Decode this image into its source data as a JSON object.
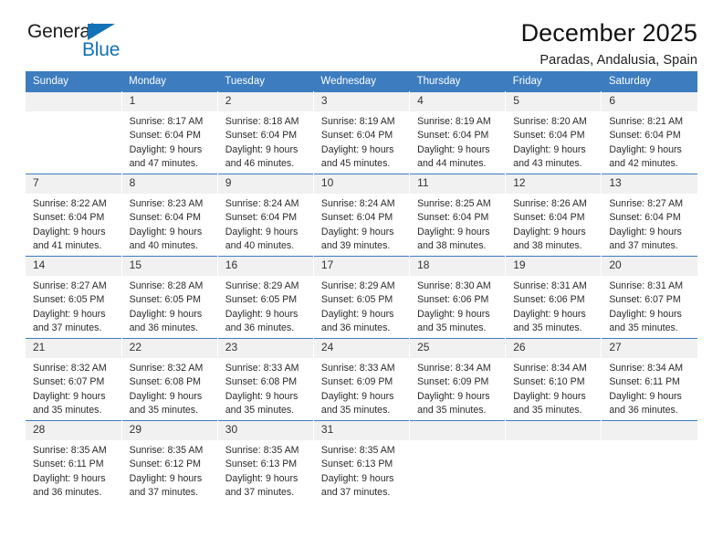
{
  "logo": {
    "general": "General",
    "blue": "Blue",
    "triangle_color": "#1272b6"
  },
  "header": {
    "title": "December 2025",
    "subtitle": "Paradas, Andalusia, Spain",
    "accent_color": "#3c7cbf"
  },
  "weekday_headers": [
    "Sunday",
    "Monday",
    "Tuesday",
    "Wednesday",
    "Thursday",
    "Friday",
    "Saturday"
  ],
  "weeks": [
    [
      {
        "day": "",
        "lines": []
      },
      {
        "day": "1",
        "lines": [
          "Sunrise: 8:17 AM",
          "Sunset: 6:04 PM",
          "Daylight: 9 hours",
          "and 47 minutes."
        ]
      },
      {
        "day": "2",
        "lines": [
          "Sunrise: 8:18 AM",
          "Sunset: 6:04 PM",
          "Daylight: 9 hours",
          "and 46 minutes."
        ]
      },
      {
        "day": "3",
        "lines": [
          "Sunrise: 8:19 AM",
          "Sunset: 6:04 PM",
          "Daylight: 9 hours",
          "and 45 minutes."
        ]
      },
      {
        "day": "4",
        "lines": [
          "Sunrise: 8:19 AM",
          "Sunset: 6:04 PM",
          "Daylight: 9 hours",
          "and 44 minutes."
        ]
      },
      {
        "day": "5",
        "lines": [
          "Sunrise: 8:20 AM",
          "Sunset: 6:04 PM",
          "Daylight: 9 hours",
          "and 43 minutes."
        ]
      },
      {
        "day": "6",
        "lines": [
          "Sunrise: 8:21 AM",
          "Sunset: 6:04 PM",
          "Daylight: 9 hours",
          "and 42 minutes."
        ]
      }
    ],
    [
      {
        "day": "7",
        "lines": [
          "Sunrise: 8:22 AM",
          "Sunset: 6:04 PM",
          "Daylight: 9 hours",
          "and 41 minutes."
        ]
      },
      {
        "day": "8",
        "lines": [
          "Sunrise: 8:23 AM",
          "Sunset: 6:04 PM",
          "Daylight: 9 hours",
          "and 40 minutes."
        ]
      },
      {
        "day": "9",
        "lines": [
          "Sunrise: 8:24 AM",
          "Sunset: 6:04 PM",
          "Daylight: 9 hours",
          "and 40 minutes."
        ]
      },
      {
        "day": "10",
        "lines": [
          "Sunrise: 8:24 AM",
          "Sunset: 6:04 PM",
          "Daylight: 9 hours",
          "and 39 minutes."
        ]
      },
      {
        "day": "11",
        "lines": [
          "Sunrise: 8:25 AM",
          "Sunset: 6:04 PM",
          "Daylight: 9 hours",
          "and 38 minutes."
        ]
      },
      {
        "day": "12",
        "lines": [
          "Sunrise: 8:26 AM",
          "Sunset: 6:04 PM",
          "Daylight: 9 hours",
          "and 38 minutes."
        ]
      },
      {
        "day": "13",
        "lines": [
          "Sunrise: 8:27 AM",
          "Sunset: 6:04 PM",
          "Daylight: 9 hours",
          "and 37 minutes."
        ]
      }
    ],
    [
      {
        "day": "14",
        "lines": [
          "Sunrise: 8:27 AM",
          "Sunset: 6:05 PM",
          "Daylight: 9 hours",
          "and 37 minutes."
        ]
      },
      {
        "day": "15",
        "lines": [
          "Sunrise: 8:28 AM",
          "Sunset: 6:05 PM",
          "Daylight: 9 hours",
          "and 36 minutes."
        ]
      },
      {
        "day": "16",
        "lines": [
          "Sunrise: 8:29 AM",
          "Sunset: 6:05 PM",
          "Daylight: 9 hours",
          "and 36 minutes."
        ]
      },
      {
        "day": "17",
        "lines": [
          "Sunrise: 8:29 AM",
          "Sunset: 6:05 PM",
          "Daylight: 9 hours",
          "and 36 minutes."
        ]
      },
      {
        "day": "18",
        "lines": [
          "Sunrise: 8:30 AM",
          "Sunset: 6:06 PM",
          "Daylight: 9 hours",
          "and 35 minutes."
        ]
      },
      {
        "day": "19",
        "lines": [
          "Sunrise: 8:31 AM",
          "Sunset: 6:06 PM",
          "Daylight: 9 hours",
          "and 35 minutes."
        ]
      },
      {
        "day": "20",
        "lines": [
          "Sunrise: 8:31 AM",
          "Sunset: 6:07 PM",
          "Daylight: 9 hours",
          "and 35 minutes."
        ]
      }
    ],
    [
      {
        "day": "21",
        "lines": [
          "Sunrise: 8:32 AM",
          "Sunset: 6:07 PM",
          "Daylight: 9 hours",
          "and 35 minutes."
        ]
      },
      {
        "day": "22",
        "lines": [
          "Sunrise: 8:32 AM",
          "Sunset: 6:08 PM",
          "Daylight: 9 hours",
          "and 35 minutes."
        ]
      },
      {
        "day": "23",
        "lines": [
          "Sunrise: 8:33 AM",
          "Sunset: 6:08 PM",
          "Daylight: 9 hours",
          "and 35 minutes."
        ]
      },
      {
        "day": "24",
        "lines": [
          "Sunrise: 8:33 AM",
          "Sunset: 6:09 PM",
          "Daylight: 9 hours",
          "and 35 minutes."
        ]
      },
      {
        "day": "25",
        "lines": [
          "Sunrise: 8:34 AM",
          "Sunset: 6:09 PM",
          "Daylight: 9 hours",
          "and 35 minutes."
        ]
      },
      {
        "day": "26",
        "lines": [
          "Sunrise: 8:34 AM",
          "Sunset: 6:10 PM",
          "Daylight: 9 hours",
          "and 35 minutes."
        ]
      },
      {
        "day": "27",
        "lines": [
          "Sunrise: 8:34 AM",
          "Sunset: 6:11 PM",
          "Daylight: 9 hours",
          "and 36 minutes."
        ]
      }
    ],
    [
      {
        "day": "28",
        "lines": [
          "Sunrise: 8:35 AM",
          "Sunset: 6:11 PM",
          "Daylight: 9 hours",
          "and 36 minutes."
        ]
      },
      {
        "day": "29",
        "lines": [
          "Sunrise: 8:35 AM",
          "Sunset: 6:12 PM",
          "Daylight: 9 hours",
          "and 37 minutes."
        ]
      },
      {
        "day": "30",
        "lines": [
          "Sunrise: 8:35 AM",
          "Sunset: 6:13 PM",
          "Daylight: 9 hours",
          "and 37 minutes."
        ]
      },
      {
        "day": "31",
        "lines": [
          "Sunrise: 8:35 AM",
          "Sunset: 6:13 PM",
          "Daylight: 9 hours",
          "and 37 minutes."
        ]
      },
      {
        "day": "",
        "lines": []
      },
      {
        "day": "",
        "lines": []
      },
      {
        "day": "",
        "lines": []
      }
    ]
  ]
}
